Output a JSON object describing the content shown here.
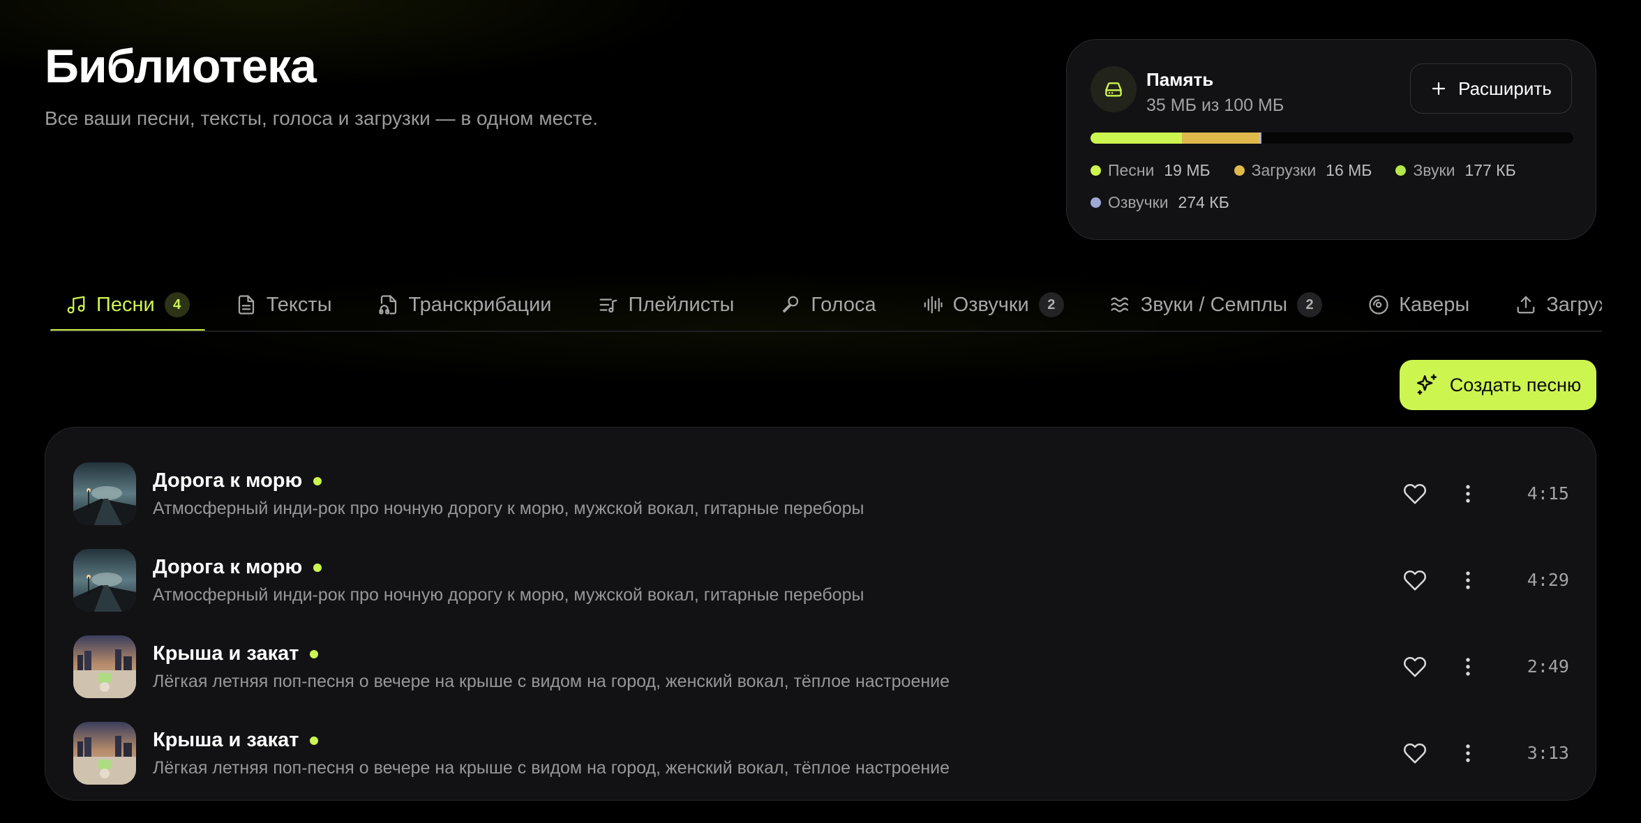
{
  "header": {
    "title": "Библиотека",
    "subtitle": "Все ваши песни, тексты, голоса и загрузки — в одном месте."
  },
  "storage": {
    "title": "Память",
    "used": "35 МБ",
    "of_word": "из",
    "total": "100 МБ",
    "icon": "hard-drive-icon",
    "expand_label": "Расширить",
    "bar": [
      {
        "key": "songs",
        "fraction": 0.19,
        "color": "#cdf550"
      },
      {
        "key": "uploads",
        "fraction": 0.16,
        "color": "#e0b94d"
      },
      {
        "key": "sounds",
        "fraction": 0.0018,
        "color": "#b5e84a"
      },
      {
        "key": "voiceovers",
        "fraction": 0.0027,
        "color": "#9fa9d6"
      }
    ],
    "legend": [
      {
        "label": "Песни",
        "value": "19 МБ",
        "color": "#cdf550"
      },
      {
        "label": "Загрузки",
        "value": "16 МБ",
        "color": "#e0b94d"
      },
      {
        "label": "Звуки",
        "value": "177 КБ",
        "color": "#b5e84a"
      },
      {
        "label": "Озвучки",
        "value": "274 КБ",
        "color": "#9fa9d6"
      }
    ]
  },
  "tabs": [
    {
      "label": "Песни",
      "icon": "music-note-icon",
      "badge": "4",
      "active": true
    },
    {
      "label": "Тексты",
      "icon": "document-icon",
      "badge": "",
      "active": false
    },
    {
      "label": "Транскрибации",
      "icon": "file-audio-icon",
      "badge": "",
      "active": false
    },
    {
      "label": "Плейлисты",
      "icon": "playlist-icon",
      "badge": "",
      "active": false
    },
    {
      "label": "Голоса",
      "icon": "microphone-icon",
      "badge": "",
      "active": false
    },
    {
      "label": "Озвучки",
      "icon": "audio-wave-icon",
      "badge": "2",
      "active": false
    },
    {
      "label": "Звуки / Семплы",
      "icon": "waves-icon",
      "badge": "2",
      "active": false
    },
    {
      "label": "Каверы",
      "icon": "disc-icon",
      "badge": "",
      "active": false
    },
    {
      "label": "Загружен",
      "icon": "upload-icon",
      "badge": "",
      "active": false
    }
  ],
  "actions": {
    "create_song_label": "Создать песню",
    "create_song_icon": "sparkles-icon"
  },
  "songs": [
    {
      "title": "Дорога к морю",
      "description": "Атмосферный инди-рок про ночную дорогу к морю, мужской вокал, гитарные переборы",
      "duration": "4:15",
      "cover": "road-to-sea"
    },
    {
      "title": "Дорога к морю",
      "description": "Атмосферный инди-рок про ночную дорогу к морю, мужской вокал, гитарные переборы",
      "duration": "4:29",
      "cover": "road-to-sea"
    },
    {
      "title": "Крыша и закат",
      "description": "Лёгкая летняя поп-песня о вечере на крыше с видом на город, женский вокал, тёплое настроение",
      "duration": "2:49",
      "cover": "rooftop-sunset"
    },
    {
      "title": "Крыша и закат",
      "description": "Лёгкая летняя поп-песня о вечере на крыше с видом на город, женский вокал, тёплое настроение",
      "duration": "3:13",
      "cover": "rooftop-sunset"
    }
  ],
  "colors": {
    "accent": "#cdf550",
    "background": "#000000",
    "card": "#121214"
  }
}
